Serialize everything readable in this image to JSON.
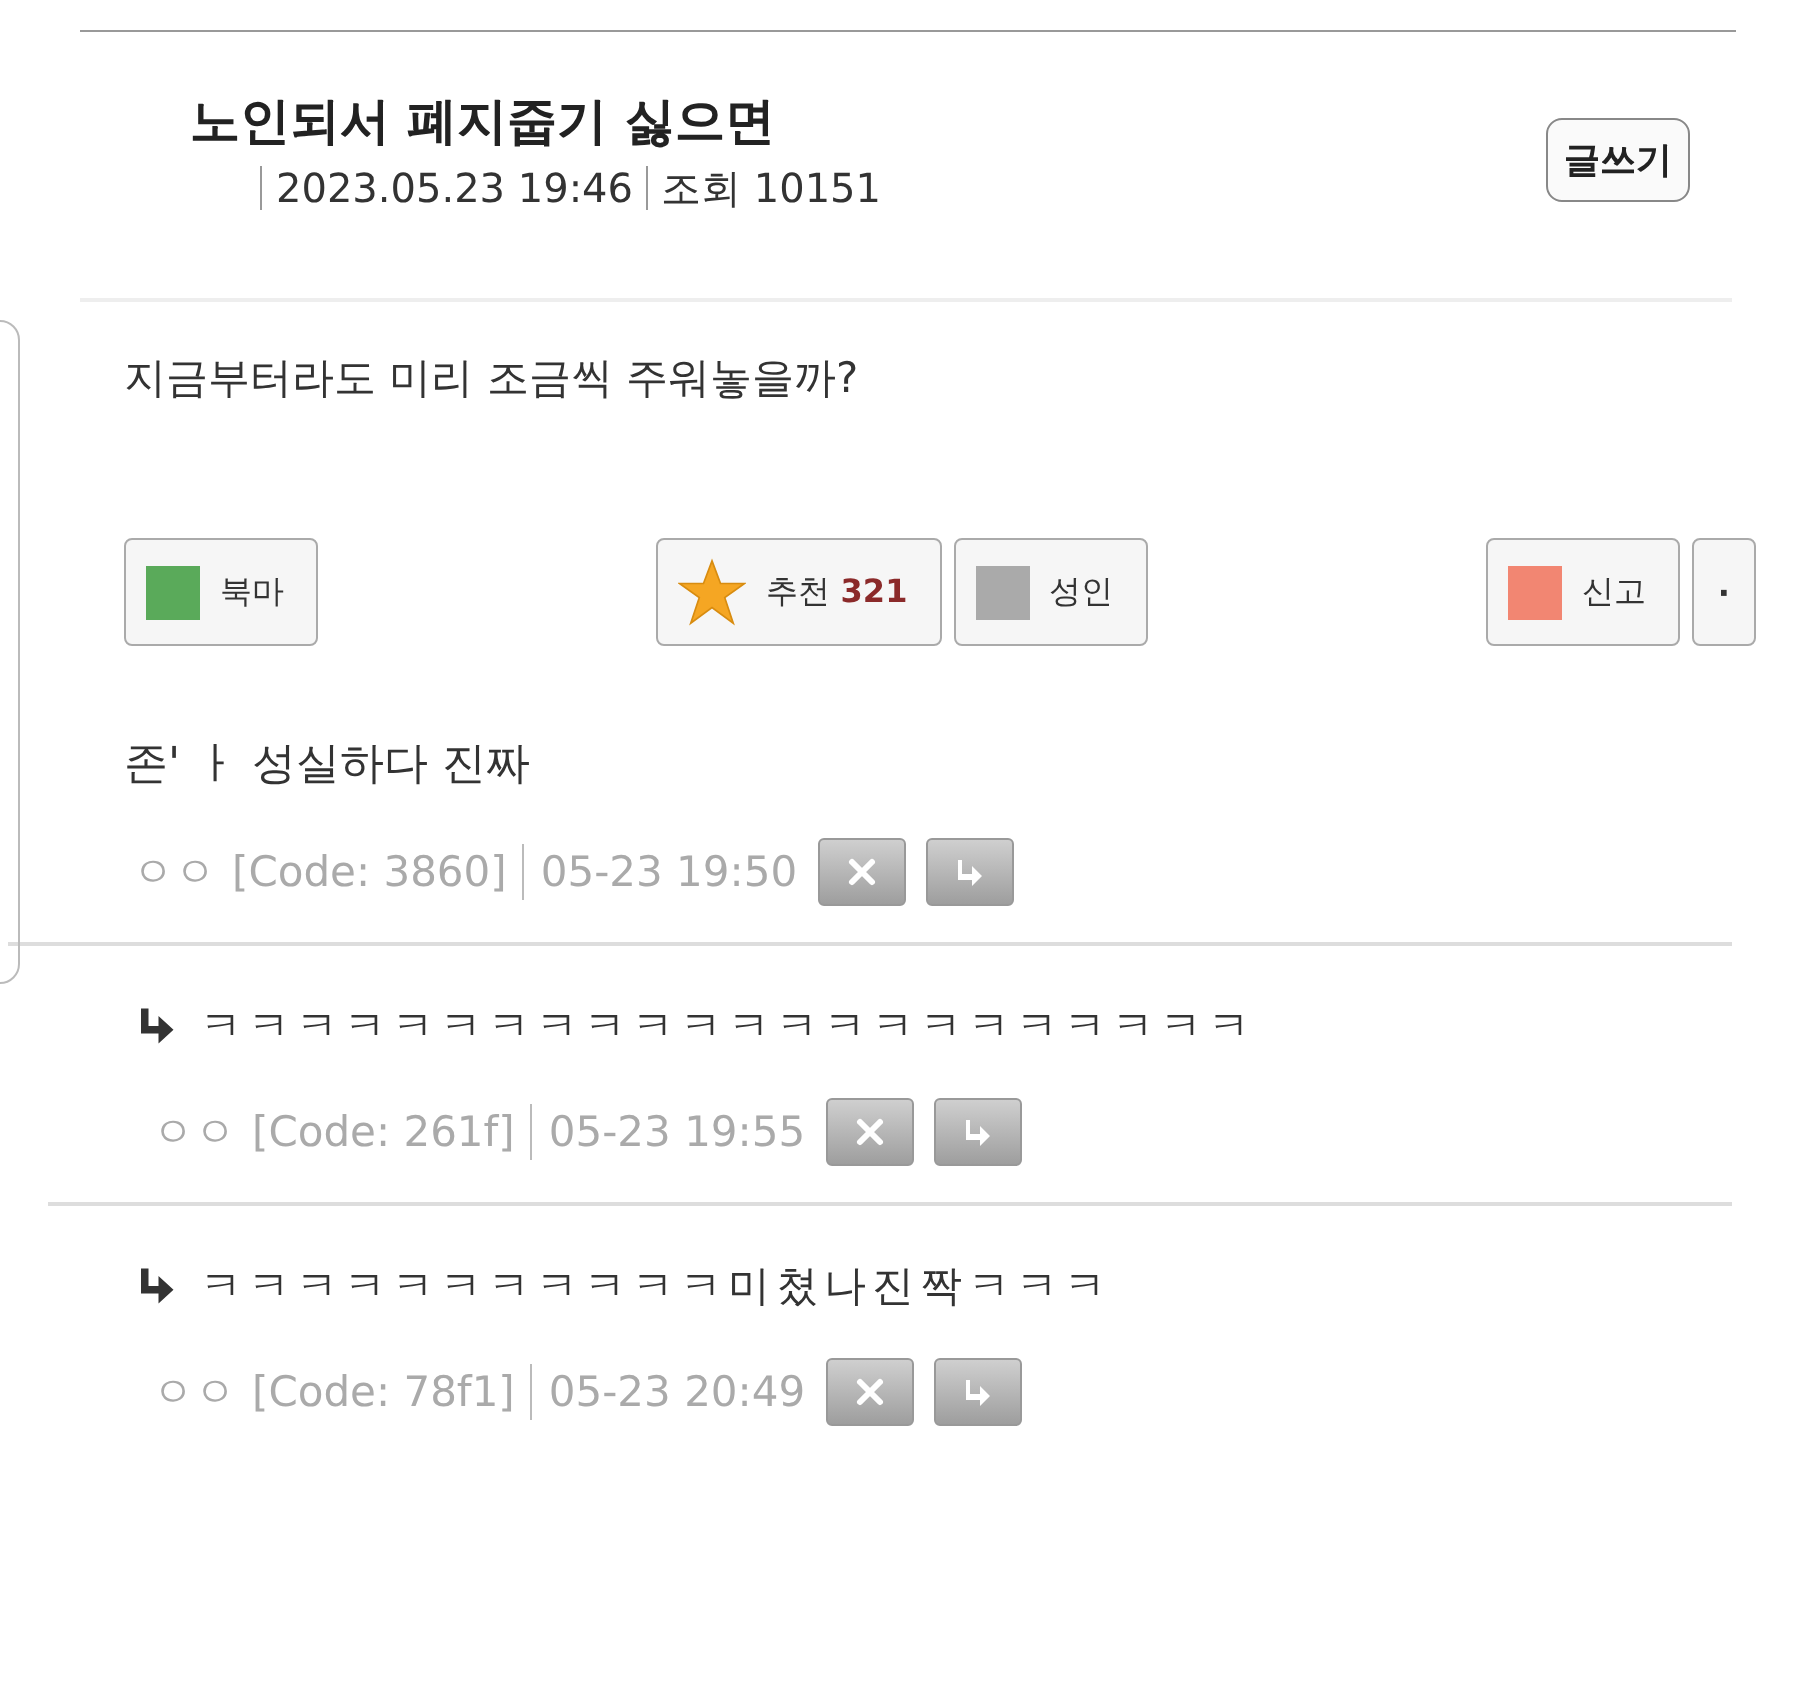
{
  "post": {
    "title": "노인되서 폐지줍기 싫으면",
    "date": "2023.05.23 19:46",
    "views": "조회 10151",
    "write_button": "글쓰기",
    "body": "지금부터라도 미리 조금씩 주워놓을까?"
  },
  "action_groups": [
    [
      {
        "kind": "swatch",
        "label": "북마",
        "color": "#5aaa5a"
      }
    ],
    [
      {
        "kind": "star",
        "label": "추천",
        "count": "321"
      },
      {
        "kind": "swatch",
        "label": "성인",
        "color": "#aaaaaa"
      }
    ],
    [
      {
        "kind": "swatch",
        "label": "신고",
        "color": "#f28672"
      },
      {
        "kind": "dot",
        "label": "·"
      }
    ]
  ],
  "comments": [
    {
      "text": "존' ㅏ 성실하다 진짜",
      "author": "ㅇㅇ",
      "code": "[Code: 3860]",
      "time": "05-23 19:50",
      "children": [
        {
          "text": "ㅋㅋㅋㅋㅋㅋㅋㅋㅋㅋㅋㅋㅋㅋㅋㅋㅋㅋㅋㅋㅋㅋ",
          "author": "ㅇㅇ",
          "code": "[Code: 261f]",
          "time": "05-23 19:55"
        },
        {
          "text": "ㅋㅋㅋㅋㅋㅋㅋㅋㅋㅋㅋ미쳤나진짝ㅋㅋㅋ",
          "author": "ㅇㅇ",
          "code": "[Code: 78f1]",
          "time": "05-23 20:49"
        }
      ]
    }
  ]
}
